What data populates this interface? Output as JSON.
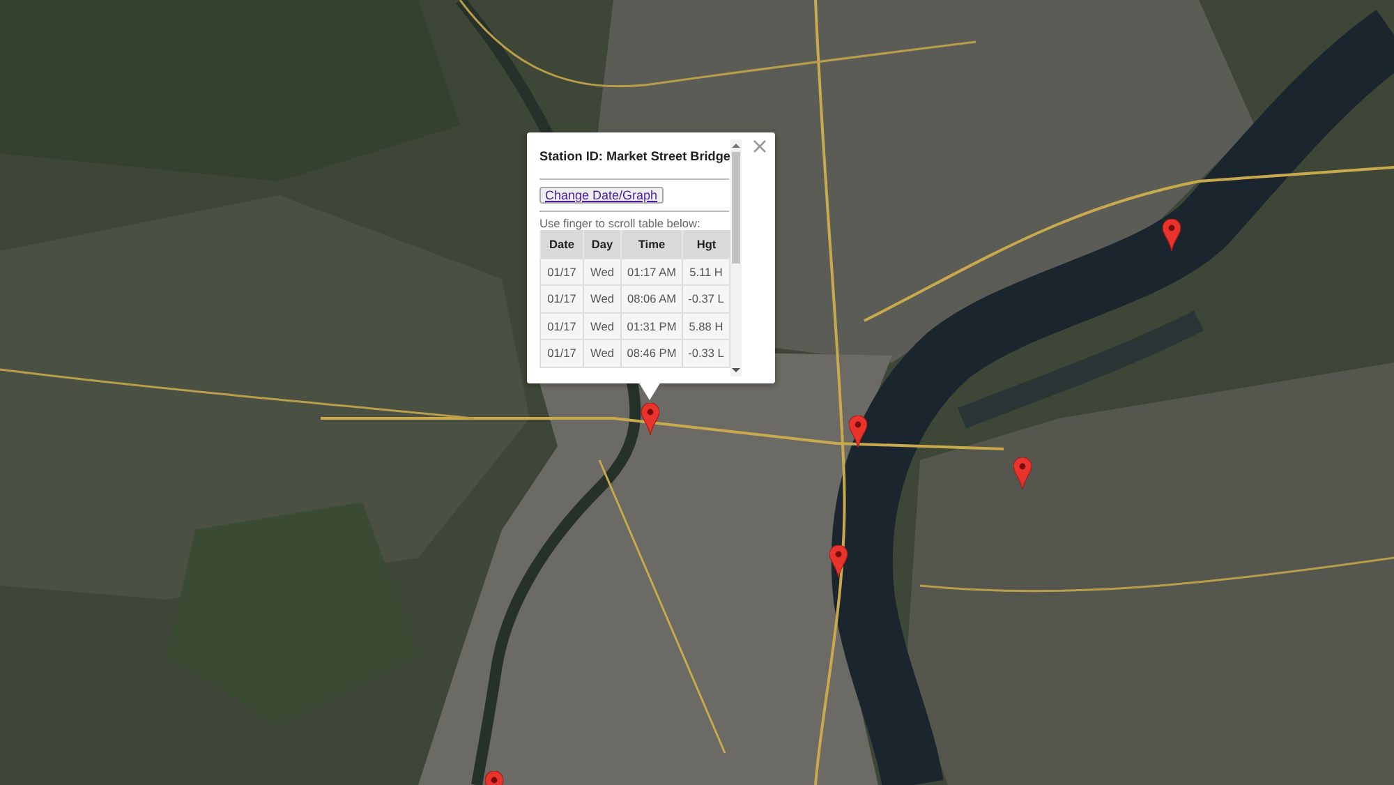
{
  "info_window": {
    "title": "Station ID: Market Street Bridge",
    "button": "Change Date/Graph",
    "hint": "Use finger to scroll table below:",
    "table": {
      "columns": [
        "Date",
        "Day",
        "Time",
        "Hgt"
      ],
      "rows": [
        [
          "01/17",
          "Wed",
          "01:17 AM",
          "5.11 H"
        ],
        [
          "01/17",
          "Wed",
          "08:06 AM",
          "-0.37 L"
        ],
        [
          "01/17",
          "Wed",
          "01:31 PM",
          "5.88 H"
        ],
        [
          "01/17",
          "Wed",
          "08:46 PM",
          "-0.33 L"
        ]
      ]
    }
  }
}
